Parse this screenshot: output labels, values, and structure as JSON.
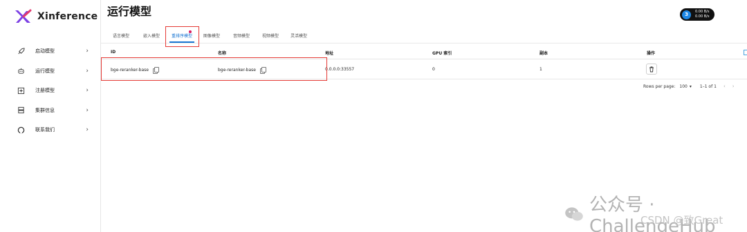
{
  "app": {
    "name": "Xinference"
  },
  "sidebar": {
    "items": [
      {
        "label": "启动模型",
        "icon": "rocket-icon"
      },
      {
        "label": "运行模型",
        "icon": "robot-icon"
      },
      {
        "label": "注册模型",
        "icon": "add-box-icon"
      },
      {
        "label": "集群信息",
        "icon": "server-icon"
      },
      {
        "label": "联系我们",
        "icon": "github-icon"
      }
    ],
    "chevron": "›"
  },
  "header": {
    "title": "运行模型",
    "network": {
      "gauge": "3",
      "up": "0.00 B/s",
      "down": "0.00 B/s"
    }
  },
  "tabs": [
    {
      "label": "语言模型"
    },
    {
      "label": "嵌入模型"
    },
    {
      "label": "重排序模型",
      "active": true
    },
    {
      "label": "图像模型"
    },
    {
      "label": "音频模型"
    },
    {
      "label": "视频模型"
    },
    {
      "label": "灵活模型"
    }
  ],
  "table": {
    "columns": [
      "ID",
      "名称",
      "地址",
      "GPU 索引",
      "副本",
      "操作"
    ],
    "rows": [
      {
        "id": "bge-reranker-base",
        "name": "bge-reranker-base",
        "address": "0.0.0.0:33557",
        "gpu_index": "0",
        "replica": "1"
      }
    ]
  },
  "pagination": {
    "rows_per_page_label": "Rows per page:",
    "rows_per_page": "100",
    "range": "1–1 of 1",
    "prev": "‹",
    "next": "›"
  },
  "watermark": {
    "main": "公众号 · ChallengeHub",
    "secondary": "CSDN @致Great"
  },
  "colors": {
    "accent": "#1976d2",
    "highlight": "#e53935",
    "badge_bg": "#111111"
  }
}
